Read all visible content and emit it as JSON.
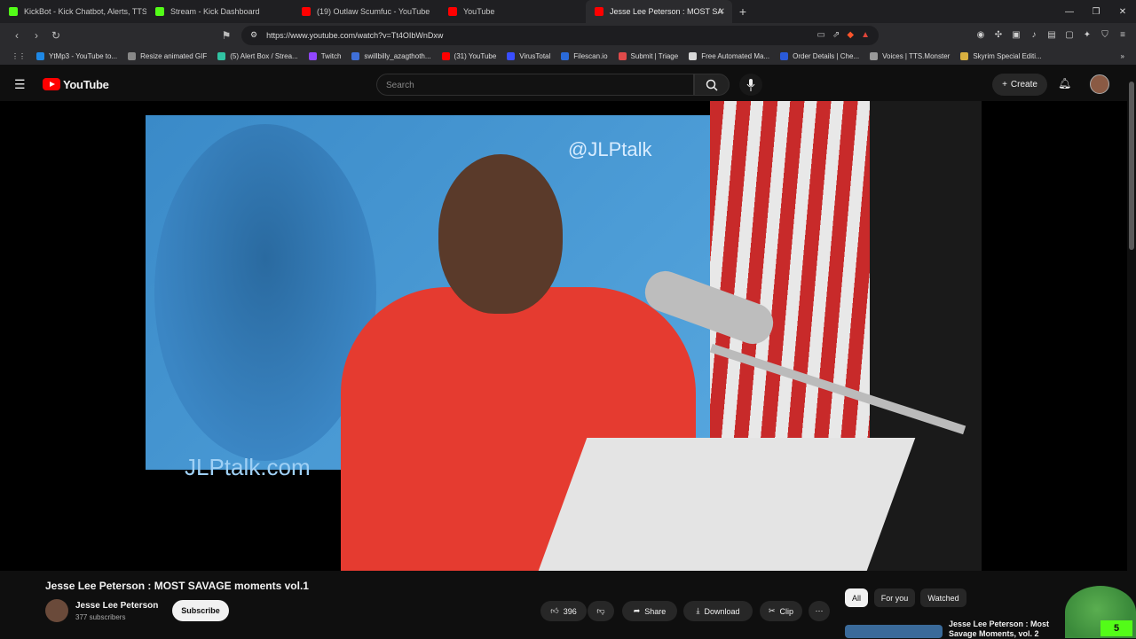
{
  "browser": {
    "tabs": [
      {
        "label": "KickBot - Kick Chatbot, Alerts, TTS, C",
        "color": "#53fc18"
      },
      {
        "label": "Stream - Kick Dashboard",
        "color": "#53fc18"
      },
      {
        "label": "(19) Outlaw Scumfuc - YouTube",
        "color": "#ff0000"
      },
      {
        "label": "YouTube",
        "color": "#ff0000"
      },
      {
        "label": "Jesse Lee Peterson : MOST SA",
        "color": "#ff0000",
        "active": true
      }
    ],
    "new_tab": "+",
    "url": "https://www.youtube.com/watch?v=Tt4OIbWnDxw",
    "bookmarks": [
      {
        "label": "YtMp3 - YouTube to...",
        "color": "#1e88e5"
      },
      {
        "label": "Resize animated GIF",
        "color": "#888888"
      },
      {
        "label": "(5) Alert Box / Strea...",
        "color": "#31c3a2"
      },
      {
        "label": "Twitch",
        "color": "#9146ff"
      },
      {
        "label": "swillbilly_azagthoth...",
        "color": "#3f6fd8"
      },
      {
        "label": "(31) YouTube",
        "color": "#ff0000"
      },
      {
        "label": "VirusTotal",
        "color": "#394eff"
      },
      {
        "label": "Filescan.io",
        "color": "#2a6ad8"
      },
      {
        "label": "Submit | Triage",
        "color": "#e04a4a"
      },
      {
        "label": "Free Automated Ma...",
        "color": "#d8d8d8"
      },
      {
        "label": "Order Details | Che...",
        "color": "#2a5ad8"
      },
      {
        "label": "Voices | TTS.Monster",
        "color": "#999999"
      },
      {
        "label": "Skyrim Special Editi...",
        "color": "#d8b040"
      }
    ]
  },
  "youtube": {
    "logo_text": "YouTube",
    "search_placeholder": "Search",
    "create_label": "Create",
    "accent": "#ff0000"
  },
  "video": {
    "overlay_handle": "@JLPtalk",
    "overlay_site": "JLPtalk.com",
    "title": "Jesse Lee Peterson : MOST SAVAGE moments vol.1",
    "channel_name": "Jesse Lee Peterson",
    "subscribers": "377 subscribers",
    "subscribe_label": "Subscribe",
    "likes": "396",
    "share_label": "Share",
    "download_label": "Download",
    "clip_label": "Clip"
  },
  "recommendations": {
    "chips": [
      "All",
      "For you",
      "Watched"
    ],
    "first_title": "Jesse Lee Peterson : Most Savage Moments, vol. 2"
  },
  "overlay": {
    "badge": "5"
  }
}
